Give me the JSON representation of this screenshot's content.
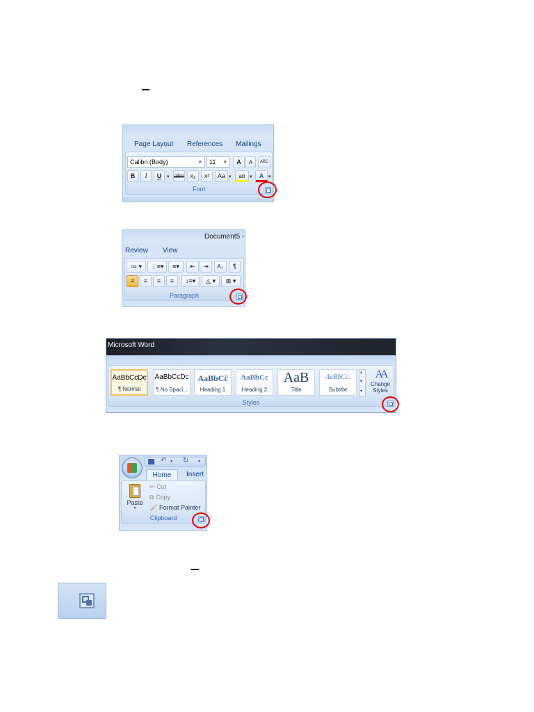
{
  "font_shot": {
    "tabs": [
      "Page Layout",
      "References",
      "Mailings"
    ],
    "font_name": "Calibri (Body)",
    "font_size": "11",
    "group_label": "Font",
    "grow_label": "A",
    "shrink_label": "A",
    "clear_label": "ABC",
    "bold": "B",
    "italic": "I",
    "underline": "U",
    "strike": "abe",
    "subscript": "x₂",
    "superscript": "x²",
    "change_case": "Aa",
    "highlight": "ab",
    "font_color": "A"
  },
  "paragraph_shot": {
    "title": "Document5 -",
    "tabs": [
      "Review",
      "View"
    ],
    "group_label": "Paragraph",
    "sort": "A↓",
    "pilcrow": "¶"
  },
  "styles_shot": {
    "title": "Microsoft Word",
    "group_label": "Styles",
    "tiles": [
      {
        "sample": "AaBbCcDc",
        "name": "¶ Normal"
      },
      {
        "sample": "AaBbCcDc",
        "name": "¶ No Spaci..."
      },
      {
        "sample": "AaBbCĉ",
        "name": "Heading 1"
      },
      {
        "sample": "AaBbCc",
        "name": "Heading 2"
      },
      {
        "sample": "AaB",
        "name": "Title"
      },
      {
        "sample": "AaBbCc.",
        "name": "Subtitle"
      }
    ],
    "change_styles": "Change Styles",
    "change_icon_text": "AA"
  },
  "clipboard_shot": {
    "tabs": [
      "Home",
      "Insert"
    ],
    "paste": "Paste",
    "cut": "Cut",
    "copy": "Copy",
    "format_painter": "Format Painter",
    "group_label": "Clipboard"
  },
  "colors": {
    "ring": "#e00000",
    "ribbon": "#d5e4f7",
    "titlebar_dark": "#1b1f27",
    "active_style": "#f5c15c"
  }
}
